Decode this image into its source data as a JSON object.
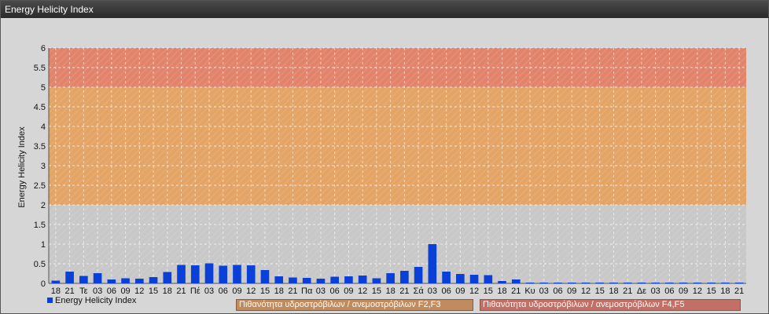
{
  "window": {
    "title": "Energy Helicity Index"
  },
  "chart_data": {
    "type": "bar",
    "title": "",
    "ylabel": "Energy Helicity Index",
    "xlabel": "",
    "ylim": [
      0,
      6
    ],
    "yticks": [
      "0",
      "0.5",
      "1",
      "1.5",
      "2",
      "2.5",
      "3",
      "3.5",
      "4",
      "4.5",
      "5",
      "5.5",
      "6"
    ],
    "categories": [
      "18",
      "21",
      "Τε",
      "03",
      "06",
      "09",
      "12",
      "15",
      "18",
      "21",
      "Πέ",
      "03",
      "06",
      "09",
      "12",
      "15",
      "18",
      "21",
      "Πα",
      "03",
      "06",
      "09",
      "12",
      "15",
      "18",
      "21",
      "Σά",
      "03",
      "06",
      "09",
      "12",
      "15",
      "18",
      "21",
      "Κυ",
      "03",
      "06",
      "09",
      "12",
      "15",
      "18",
      "21",
      "Δε",
      "03",
      "06",
      "09",
      "12",
      "15",
      "18",
      "21"
    ],
    "series": [
      {
        "name": "Energy Helicity Index",
        "color": "#0a3fd8",
        "values": [
          0.07,
          0.3,
          0.19,
          0.26,
          0.1,
          0.13,
          0.12,
          0.16,
          0.29,
          0.47,
          0.46,
          0.51,
          0.45,
          0.47,
          0.46,
          0.34,
          0.18,
          0.15,
          0.14,
          0.12,
          0.17,
          0.18,
          0.2,
          0.13,
          0.26,
          0.32,
          0.42,
          1.0,
          0.3,
          0.24,
          0.22,
          0.21,
          0.06,
          0.1,
          0.02,
          0.02,
          0.02,
          0.02,
          0.02,
          0.02,
          0.02,
          0.02,
          0.02,
          0.02,
          0.02,
          0.02,
          0.02,
          0.02,
          0.02,
          0.02
        ]
      }
    ],
    "bands": [
      {
        "from": 0,
        "to": 2,
        "color": "#c8c8c8"
      },
      {
        "from": 2,
        "to": 5,
        "color": "#e3a466"
      },
      {
        "from": 5,
        "to": 6,
        "color": "#e2846b"
      }
    ],
    "legend": {
      "placement": "bottom-left",
      "series_label": "Energy Helicity Index",
      "band_f23_label": "Πιθανότητα υδροστρόβιλων / ανεμοστρόβιλων F2,F3",
      "band_f45_label": "Πιθανότητα υδροστρόβιλων / ανεμοστρόβιλων F4,F5"
    },
    "grid": true
  }
}
